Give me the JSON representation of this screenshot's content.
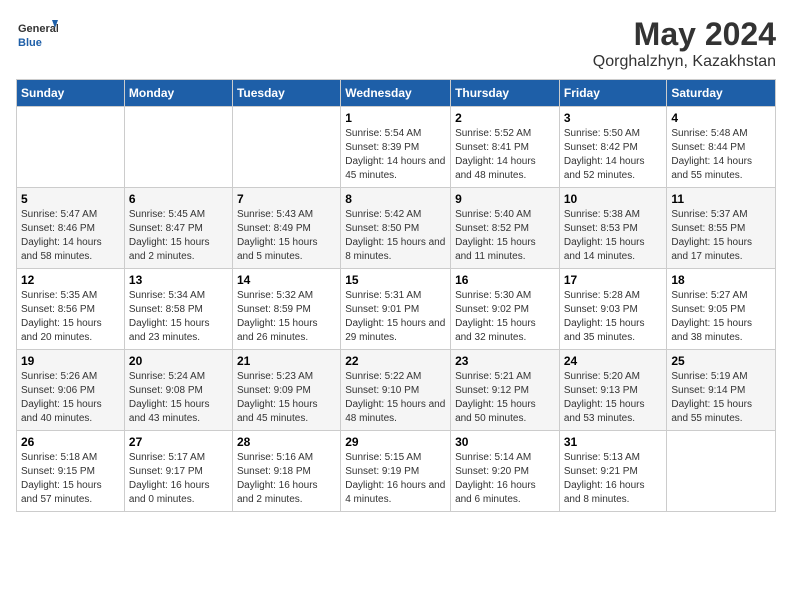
{
  "header": {
    "logo_general": "General",
    "logo_blue": "Blue",
    "title": "May 2024",
    "subtitle": "Qorghalzhyn, Kazakhstan"
  },
  "days_of_week": [
    "Sunday",
    "Monday",
    "Tuesday",
    "Wednesday",
    "Thursday",
    "Friday",
    "Saturday"
  ],
  "weeks": [
    [
      {
        "day": "",
        "info": ""
      },
      {
        "day": "",
        "info": ""
      },
      {
        "day": "",
        "info": ""
      },
      {
        "day": "1",
        "info": "Sunrise: 5:54 AM\nSunset: 8:39 PM\nDaylight: 14 hours\nand 45 minutes."
      },
      {
        "day": "2",
        "info": "Sunrise: 5:52 AM\nSunset: 8:41 PM\nDaylight: 14 hours\nand 48 minutes."
      },
      {
        "day": "3",
        "info": "Sunrise: 5:50 AM\nSunset: 8:42 PM\nDaylight: 14 hours\nand 52 minutes."
      },
      {
        "day": "4",
        "info": "Sunrise: 5:48 AM\nSunset: 8:44 PM\nDaylight: 14 hours\nand 55 minutes."
      }
    ],
    [
      {
        "day": "5",
        "info": "Sunrise: 5:47 AM\nSunset: 8:46 PM\nDaylight: 14 hours\nand 58 minutes."
      },
      {
        "day": "6",
        "info": "Sunrise: 5:45 AM\nSunset: 8:47 PM\nDaylight: 15 hours\nand 2 minutes."
      },
      {
        "day": "7",
        "info": "Sunrise: 5:43 AM\nSunset: 8:49 PM\nDaylight: 15 hours\nand 5 minutes."
      },
      {
        "day": "8",
        "info": "Sunrise: 5:42 AM\nSunset: 8:50 PM\nDaylight: 15 hours\nand 8 minutes."
      },
      {
        "day": "9",
        "info": "Sunrise: 5:40 AM\nSunset: 8:52 PM\nDaylight: 15 hours\nand 11 minutes."
      },
      {
        "day": "10",
        "info": "Sunrise: 5:38 AM\nSunset: 8:53 PM\nDaylight: 15 hours\nand 14 minutes."
      },
      {
        "day": "11",
        "info": "Sunrise: 5:37 AM\nSunset: 8:55 PM\nDaylight: 15 hours\nand 17 minutes."
      }
    ],
    [
      {
        "day": "12",
        "info": "Sunrise: 5:35 AM\nSunset: 8:56 PM\nDaylight: 15 hours\nand 20 minutes."
      },
      {
        "day": "13",
        "info": "Sunrise: 5:34 AM\nSunset: 8:58 PM\nDaylight: 15 hours\nand 23 minutes."
      },
      {
        "day": "14",
        "info": "Sunrise: 5:32 AM\nSunset: 8:59 PM\nDaylight: 15 hours\nand 26 minutes."
      },
      {
        "day": "15",
        "info": "Sunrise: 5:31 AM\nSunset: 9:01 PM\nDaylight: 15 hours\nand 29 minutes."
      },
      {
        "day": "16",
        "info": "Sunrise: 5:30 AM\nSunset: 9:02 PM\nDaylight: 15 hours\nand 32 minutes."
      },
      {
        "day": "17",
        "info": "Sunrise: 5:28 AM\nSunset: 9:03 PM\nDaylight: 15 hours\nand 35 minutes."
      },
      {
        "day": "18",
        "info": "Sunrise: 5:27 AM\nSunset: 9:05 PM\nDaylight: 15 hours\nand 38 minutes."
      }
    ],
    [
      {
        "day": "19",
        "info": "Sunrise: 5:26 AM\nSunset: 9:06 PM\nDaylight: 15 hours\nand 40 minutes."
      },
      {
        "day": "20",
        "info": "Sunrise: 5:24 AM\nSunset: 9:08 PM\nDaylight: 15 hours\nand 43 minutes."
      },
      {
        "day": "21",
        "info": "Sunrise: 5:23 AM\nSunset: 9:09 PM\nDaylight: 15 hours\nand 45 minutes."
      },
      {
        "day": "22",
        "info": "Sunrise: 5:22 AM\nSunset: 9:10 PM\nDaylight: 15 hours\nand 48 minutes."
      },
      {
        "day": "23",
        "info": "Sunrise: 5:21 AM\nSunset: 9:12 PM\nDaylight: 15 hours\nand 50 minutes."
      },
      {
        "day": "24",
        "info": "Sunrise: 5:20 AM\nSunset: 9:13 PM\nDaylight: 15 hours\nand 53 minutes."
      },
      {
        "day": "25",
        "info": "Sunrise: 5:19 AM\nSunset: 9:14 PM\nDaylight: 15 hours\nand 55 minutes."
      }
    ],
    [
      {
        "day": "26",
        "info": "Sunrise: 5:18 AM\nSunset: 9:15 PM\nDaylight: 15 hours\nand 57 minutes."
      },
      {
        "day": "27",
        "info": "Sunrise: 5:17 AM\nSunset: 9:17 PM\nDaylight: 16 hours\nand 0 minutes."
      },
      {
        "day": "28",
        "info": "Sunrise: 5:16 AM\nSunset: 9:18 PM\nDaylight: 16 hours\nand 2 minutes."
      },
      {
        "day": "29",
        "info": "Sunrise: 5:15 AM\nSunset: 9:19 PM\nDaylight: 16 hours\nand 4 minutes."
      },
      {
        "day": "30",
        "info": "Sunrise: 5:14 AM\nSunset: 9:20 PM\nDaylight: 16 hours\nand 6 minutes."
      },
      {
        "day": "31",
        "info": "Sunrise: 5:13 AM\nSunset: 9:21 PM\nDaylight: 16 hours\nand 8 minutes."
      },
      {
        "day": "",
        "info": ""
      }
    ]
  ]
}
